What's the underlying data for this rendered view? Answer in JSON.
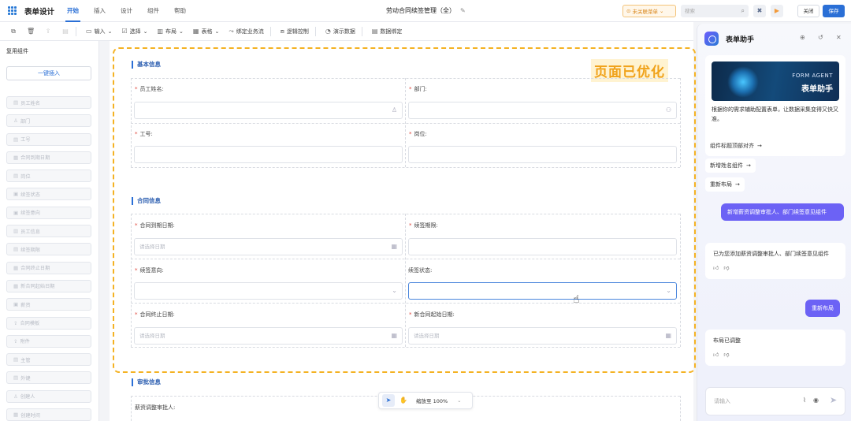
{
  "app": {
    "title": "表单设计"
  },
  "menu": [
    "开始",
    "插入",
    "设计",
    "组件",
    "帮助"
  ],
  "doc_title": "劳动合同续签管理（全）",
  "unlinked_label": "未关联菜单",
  "search": {
    "placeholder": "搜索"
  },
  "buttons": {
    "close": "关闭",
    "save": "保存"
  },
  "toolbar": {
    "items": [
      "输入",
      "选择",
      "布局",
      "表格",
      "绑定业务流",
      "逻辑控制",
      "演示数据",
      "数据绑定"
    ]
  },
  "sidebar": {
    "title": "复用组件",
    "insert_label": "一键插入",
    "items": [
      "员工姓名",
      "部门",
      "工号",
      "合同到期日期",
      "岗位",
      "续签状态",
      "续签意向",
      "员工信息",
      "续签期限",
      "合同终止日期",
      "新合同起始日期",
      "薪资",
      "合同模板",
      "附件",
      "主管",
      "外键",
      "创建人",
      "创建时间"
    ]
  },
  "canvas": {
    "optimized_label": "页面已优化",
    "sections": {
      "basic": "基本信息",
      "contract": "合同信息",
      "approval": "审批信息"
    },
    "fields": {
      "employee_name": "员工姓名:",
      "department": "部门:",
      "employee_no": "工号:",
      "position": "岗位:",
      "expiry_date": "合同到期日期:",
      "renew_term": "续签期限:",
      "renew_intent": "续签意向:",
      "renew_status": "续签状态:",
      "end_date": "合同终止日期:",
      "new_start_date": "新合同起始日期:",
      "salary_approver": "薪资调整审批人:"
    },
    "date_placeholder": "请选择日期"
  },
  "zoom": {
    "label": "缩放至 100%"
  },
  "panel": {
    "title": "表单助手",
    "banner_en": "FORM AGENT",
    "banner_cn": "表单助手",
    "desc": "根据你的需求辅助配置表单，让数据采集变得又快又准。",
    "suggestions": [
      "组件标题顶部对齐",
      "新增姓名组件",
      "重新布局"
    ],
    "messages": [
      {
        "role": "user",
        "text": "新增薪资调整审批人、部门续签意见组件"
      },
      {
        "role": "ai",
        "text": "已为您添加薪资调整审批人、部门续签意见组件"
      },
      {
        "role": "user",
        "text": "重新布局"
      },
      {
        "role": "ai",
        "text": "布局已调整"
      }
    ],
    "input_placeholder": "请输入"
  }
}
